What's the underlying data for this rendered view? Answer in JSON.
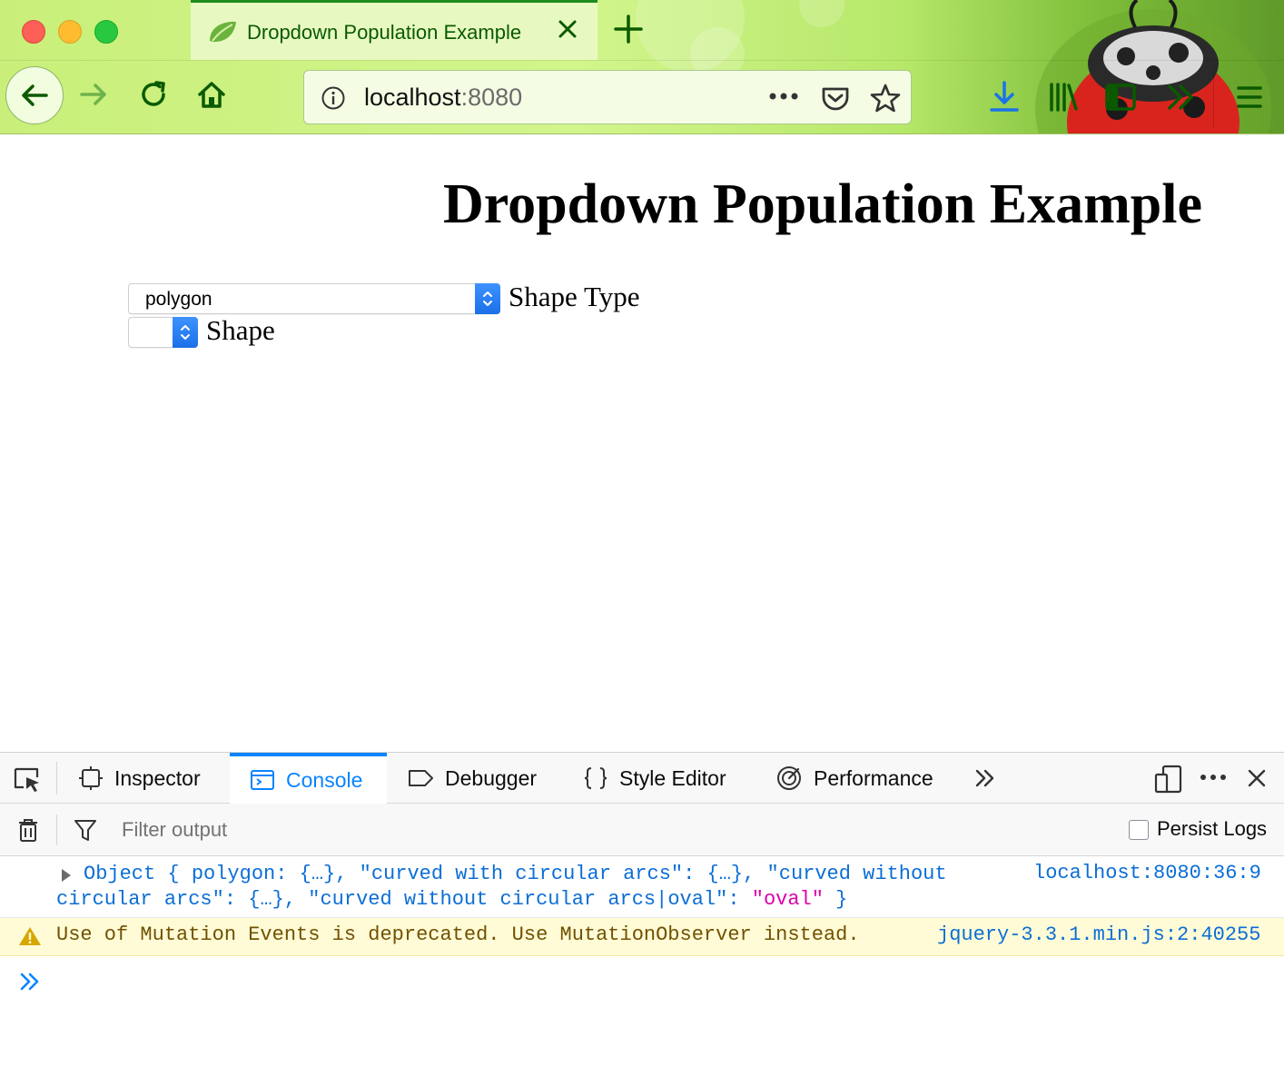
{
  "browser": {
    "tab_title": "Dropdown Population Example",
    "url_host": "localhost",
    "url_port": ":8080"
  },
  "page": {
    "title": "Dropdown Population Example",
    "shape_type_select": {
      "value": "polygon",
      "label": "Shape Type"
    },
    "shape_select": {
      "value": "",
      "label": "Shape"
    }
  },
  "devtools": {
    "tabs": [
      "Inspector",
      "Console",
      "Debugger",
      "Style Editor",
      "Performance"
    ],
    "active_tab": "Console",
    "filter_placeholder": "Filter output",
    "persist_logs_label": "Persist Logs",
    "log": {
      "p1": "Object { polygon: {…}, ",
      "s1": "\"curved with circular arcs\"",
      "p2": ": {…}, ",
      "s2": "\"curved without circular arcs\"",
      "p3": ": {…}, ",
      "s3": "\"curved without circular arcs|oval\"",
      "p4": ": ",
      "s4": "\"oval\"",
      "p5": " }",
      "location": "localhost:8080:36:9"
    },
    "warning": {
      "text": "Use of Mutation Events is deprecated. Use MutationObserver instead.",
      "location": "jquery-3.3.1.min.js:2:40255"
    }
  },
  "colors": {
    "accent": "#0a84ff",
    "chrome_green": "#0a5a00",
    "warning_bg": "#fffbd6"
  }
}
